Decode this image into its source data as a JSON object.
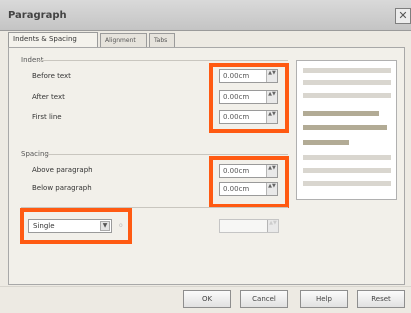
{
  "window": {
    "title": "Paragraph",
    "close_glyph": "✕"
  },
  "tabs": [
    {
      "label": "Indents & Spacing",
      "active": true
    },
    {
      "label": "Alignment",
      "active": false
    },
    {
      "label": "Tabs",
      "active": false
    }
  ],
  "indent": {
    "section_label": "Indent",
    "fields": [
      {
        "label": "Before text",
        "value": "0.00cm"
      },
      {
        "label": "After text",
        "value": "0.00cm"
      },
      {
        "label": "First line",
        "value": "0.00cm"
      }
    ]
  },
  "spacing": {
    "section_label": "Spacing",
    "fields": [
      {
        "label": "Above paragraph",
        "value": "0.00cm"
      },
      {
        "label": "Below paragraph",
        "value": "0.00cm"
      }
    ]
  },
  "line_spacing": {
    "selected": "Single",
    "of_label": "o",
    "value": ""
  },
  "buttons": {
    "ok": "OK",
    "cancel": "Cancel",
    "help": "Help",
    "reset": "Reset"
  },
  "icons": {
    "spin": "▲▼",
    "dropdown": "▼"
  },
  "colors": {
    "highlight": "#ff5a12",
    "preview_text": "#b2ab95"
  }
}
